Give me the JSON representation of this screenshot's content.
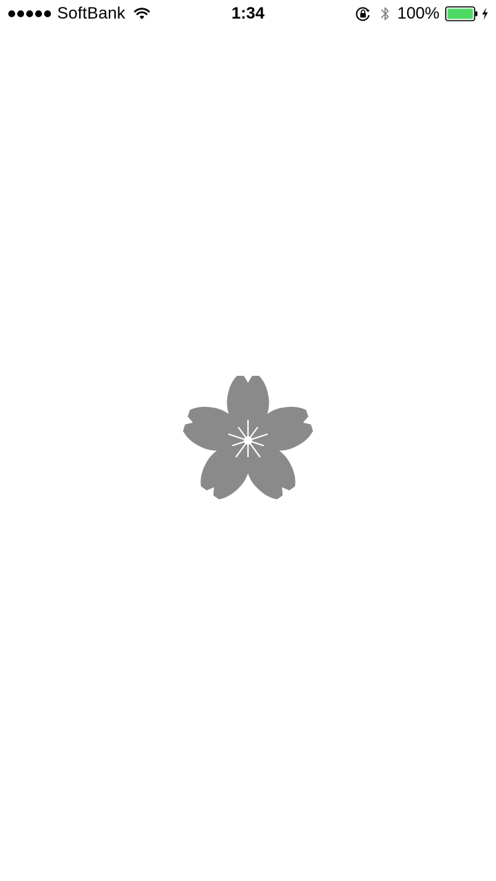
{
  "status_bar": {
    "carrier": "SoftBank",
    "time": "1:34",
    "battery_percent": "100%",
    "battery_level": 1.0,
    "signal_bars": 5,
    "icons": [
      "signal-dots-icon",
      "wifi-icon",
      "orientation-lock-icon",
      "bluetooth-icon",
      "battery-icon",
      "charging-icon"
    ],
    "battery_color": "#4cd964"
  },
  "splash": {
    "logo": "cherry-blossom-icon",
    "logo_color": "#8a8a8a"
  }
}
